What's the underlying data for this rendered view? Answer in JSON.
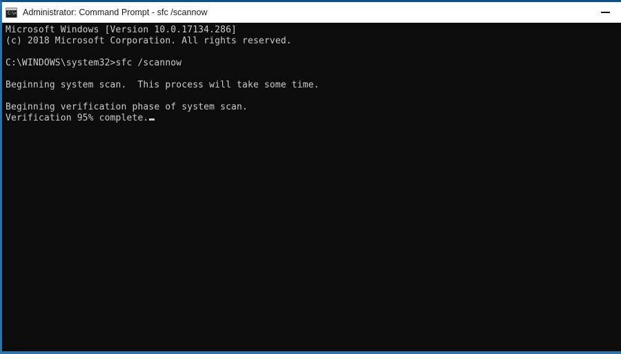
{
  "window": {
    "title": "Administrator: Command Prompt - sfc  /scannow",
    "icon_name": "command-prompt-icon",
    "icon_glyph": "C:\\>",
    "accent_border_color": "#0e5189",
    "titlebar_background": "#ffffff",
    "titlebar_text_color": "#1a1a1a"
  },
  "titlebar_buttons": {
    "minimize_label": "—",
    "minimize_name": "minimize-button"
  },
  "terminal": {
    "background": "#0c0c0c",
    "foreground": "#cccccc",
    "lines": [
      "Microsoft Windows [Version 10.0.17134.286]",
      "(c) 2018 Microsoft Corporation. All rights reserved.",
      "",
      "C:\\WINDOWS\\system32>sfc /scannow",
      "",
      "Beginning system scan.  This process will take some time.",
      "",
      "Beginning verification phase of system scan.",
      "Verification 95% complete."
    ],
    "prompt_path": "C:\\WINDOWS\\system32>",
    "command": "sfc /scannow",
    "progress_percent": "95%",
    "cursor_visible": true
  }
}
